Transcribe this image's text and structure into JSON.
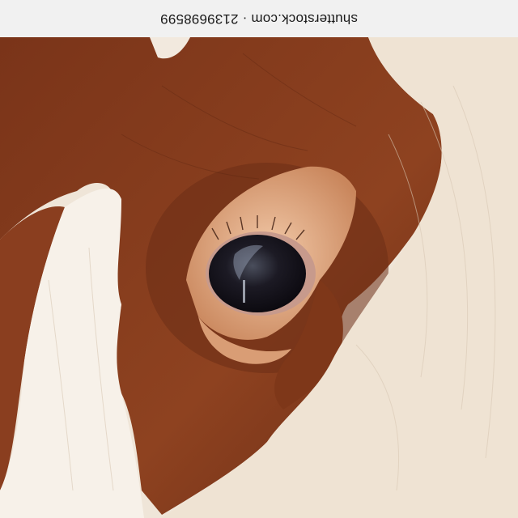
{
  "watermark": {
    "text": "shutterstock.com · 2139698599"
  },
  "photo": {
    "subject_icon": "cow-eye-closeup",
    "colors": {
      "brown": "#8a3e1f",
      "brown_dark": "#5e2614",
      "cream": "#efe4d6",
      "white": "#f7f2ec",
      "iris": "#1a1620",
      "lid": "#e8b995"
    }
  }
}
